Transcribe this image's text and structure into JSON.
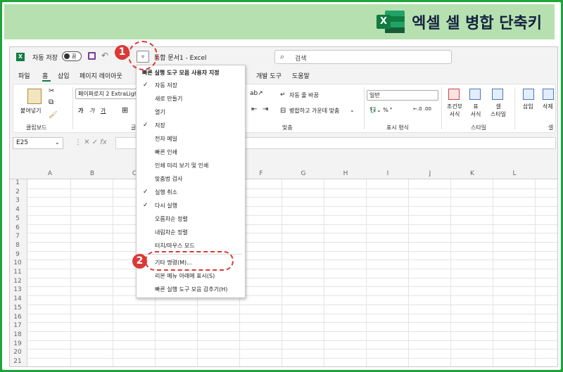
{
  "banner": {
    "title": "엑셀 셀 병합 단축키",
    "logo_letter": "X"
  },
  "titlebar": {
    "autosave_label": "자동 저장",
    "toggle_state": "끔",
    "doc_title": "통합 문서1  -  Excel",
    "search_placeholder": "검색"
  },
  "menubar": {
    "tabs": [
      "파일",
      "홈",
      "삽입",
      "페이지 레이아웃",
      "개발 도구",
      "도움말"
    ]
  },
  "ribbon": {
    "paste_label": "붙여넣기",
    "clipboard_group": "클립보드",
    "font_name": "페이퍼로지 2 ExtraLight",
    "font_group_partial": "글",
    "bold": "가",
    "italic": "가",
    "underline": "가",
    "wrap_text": "자동 줄 바꿈",
    "merge_center": "병합하고 가운데 맞춤",
    "align_group": "맞춤",
    "number_format": "일반",
    "number_group": "표시 형식",
    "cond_format": "조건부\n서식",
    "table_format": "표\n서식",
    "cell_style": "셀\n스타일",
    "style_group": "스타일",
    "insert_label": "삽입",
    "delete_label": "삭제",
    "cells_group_partial": "셀"
  },
  "formula_bar": {
    "name_box": "E25",
    "fx": "fx"
  },
  "columns": [
    "A",
    "B",
    "C",
    "D",
    "E",
    "F",
    "G",
    "H",
    "I",
    "J",
    "K",
    "L"
  ],
  "rows": [
    "1",
    "2",
    "3",
    "4",
    "5",
    "6",
    "7",
    "8",
    "9",
    "10",
    "11",
    "12",
    "13",
    "14",
    "15",
    "16",
    "17",
    "18",
    "19",
    "20",
    "21"
  ],
  "qat_menu": {
    "title": "빠른 실행 도구 모음 사용자 지정",
    "items": [
      {
        "label": "자동 저장",
        "checked": true
      },
      {
        "label": "새로 만들기",
        "checked": false
      },
      {
        "label": "열기",
        "checked": false
      },
      {
        "label": "저장",
        "checked": true
      },
      {
        "label": "전자 메일",
        "checked": false
      },
      {
        "label": "빠른 인쇄",
        "checked": false
      },
      {
        "label": "인쇄 미리 보기 및 인쇄",
        "checked": false
      },
      {
        "label": "맞춤법 검사",
        "checked": false
      },
      {
        "label": "실행 취소",
        "checked": true
      },
      {
        "label": "다시 실행",
        "checked": true
      },
      {
        "label": "오름차순 정렬",
        "checked": false
      },
      {
        "label": "내림차순 정렬",
        "checked": false
      },
      {
        "label": "터치/마우스 모드",
        "checked": false
      },
      {
        "label": "기타 명령(M)...",
        "checked": false
      },
      {
        "label": "리본 메뉴 아래에 표시(S)",
        "checked": false
      },
      {
        "label": "빠른 실행 도구 모음 감추기(H)",
        "checked": false
      }
    ]
  },
  "callouts": [
    "1",
    "2"
  ],
  "colors": {
    "accent": "#d93a35",
    "excel_green": "#107c41",
    "banner_bg": "#b6e0b0",
    "frame": "#1fa33d"
  }
}
